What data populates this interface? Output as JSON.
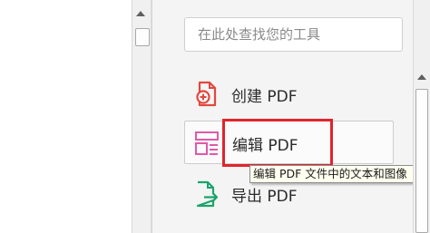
{
  "search": {
    "placeholder": "在此处查找您的工具"
  },
  "tools": {
    "create_label": "创建 PDF",
    "edit_label": "编辑 PDF",
    "export_label": "导出 PDF"
  },
  "tooltip": {
    "text": "编辑 PDF 文件中的文本和图像"
  },
  "icons": {
    "create": "create-pdf-icon",
    "edit": "edit-pdf-icon",
    "export": "export-pdf-icon"
  },
  "colors": {
    "create_icon": "#e2483d",
    "edit_icon": "#e05aa8",
    "export_icon": "#1aa36b",
    "highlight": "#e0242c"
  }
}
